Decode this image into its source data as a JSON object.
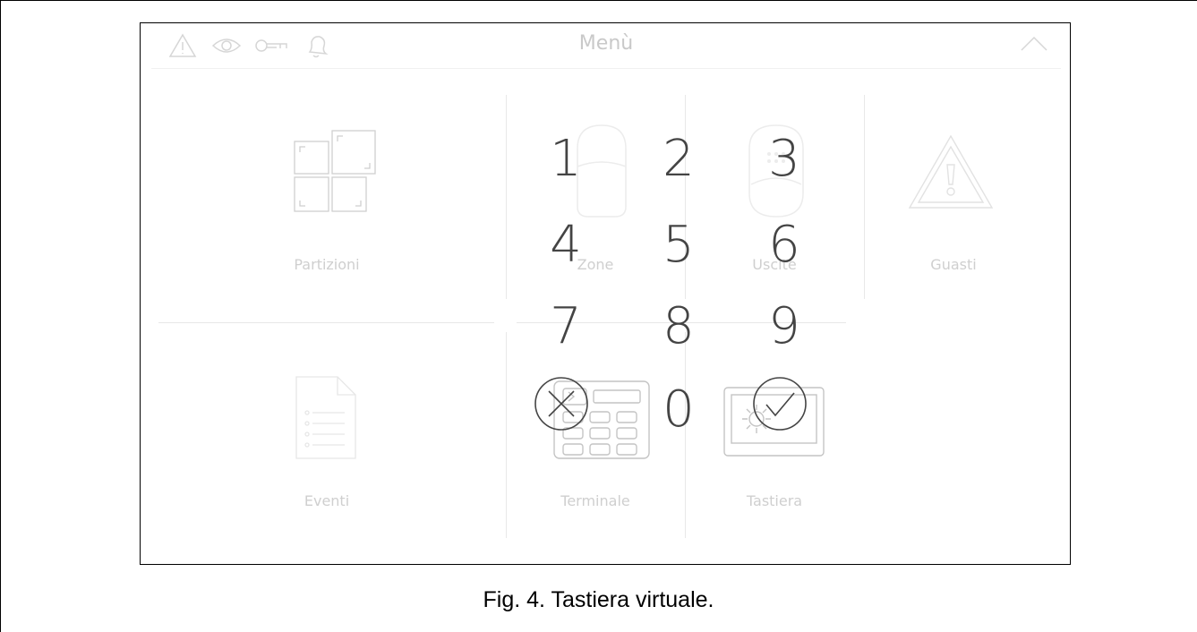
{
  "header": {
    "title": "Menù"
  },
  "tiles": {
    "partizioni": "Partizioni",
    "zone": "Zone",
    "uscite": "Uscite",
    "guasti": "Guasti",
    "eventi": "Eventi",
    "terminale": "Terminale",
    "tastiera": "Tastiera"
  },
  "keypad": {
    "keys": [
      "1",
      "2",
      "3",
      "4",
      "5",
      "6",
      "7",
      "8",
      "9",
      "0"
    ],
    "cancel_icon": "cancel-circle-icon",
    "confirm_icon": "check-circle-icon"
  },
  "icons": [
    "warning-icon",
    "eye-icon",
    "key-icon",
    "bell-icon",
    "chevron-up-icon"
  ],
  "caption": "Fig. 4. Tastiera virtuale.",
  "colors": {
    "keypad_text": "#444444",
    "faded_ui": "#d9d9d9"
  }
}
